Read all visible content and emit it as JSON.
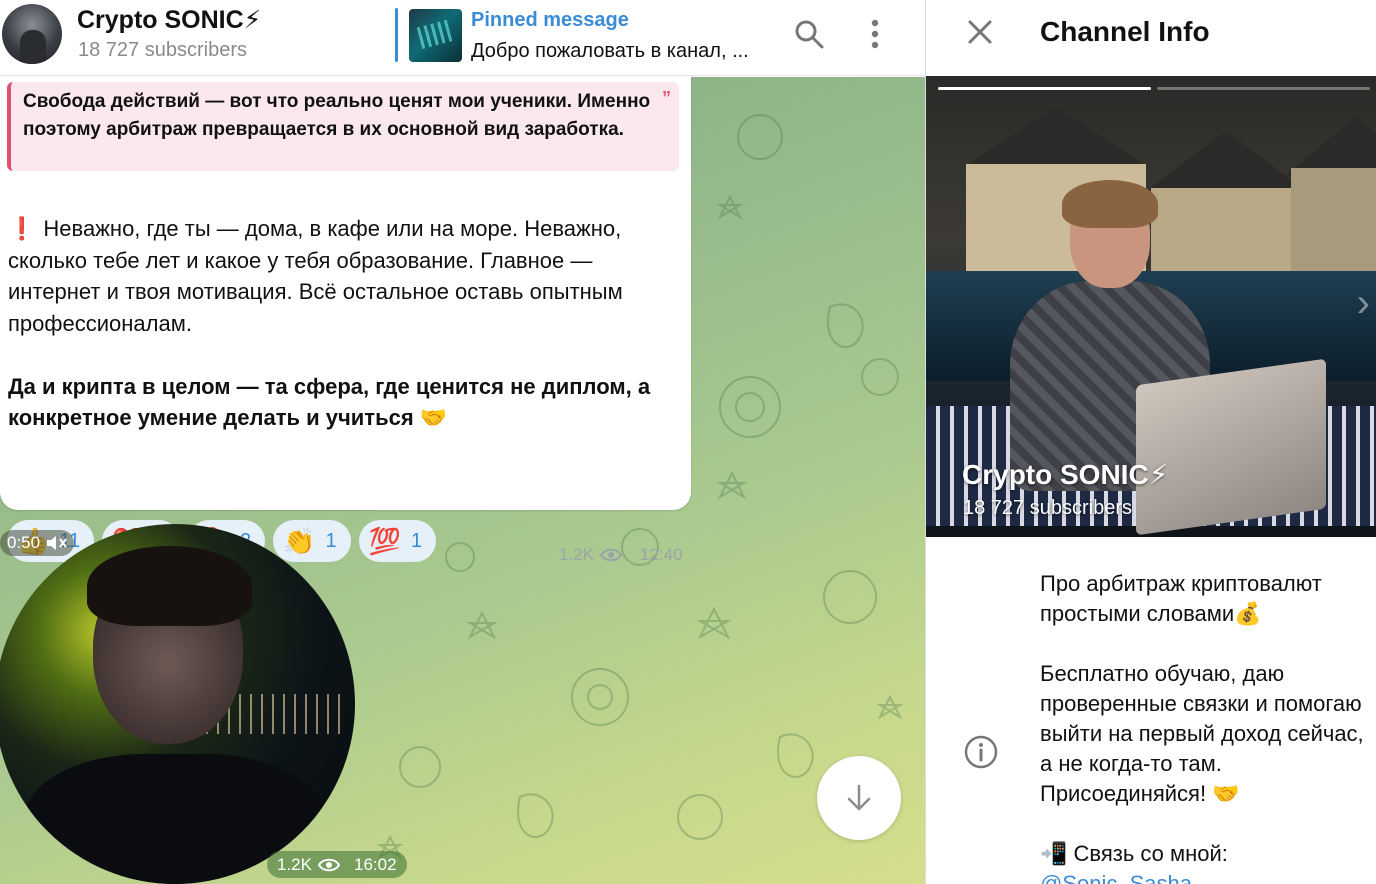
{
  "header": {
    "channel_name": "Crypto SONIC⚡",
    "subscribers": "18 727 subscribers",
    "pinned_label": "Pinned message",
    "pinned_text": "Добро пожаловать в канал, ..."
  },
  "message": {
    "quote": "Свобода действий — вот что реально ценят мои ученики. Именно поэтому арбитраж превращается в их основной вид заработка.",
    "para1_icon": "❗",
    "para1": "Неважно, где ты — дома, в кафе или на море. Неважно, сколько тебе лет и какое у тебя образование. Главное — интернет и твоя мотивация. Всё остальное оставь опытным профессионалам.",
    "para2": "Да и крипта в целом — та сфера, где ценится не диплом, а конкретное умение делать и учиться 🤝",
    "reactions": [
      {
        "emoji": "👍",
        "count": "11"
      },
      {
        "emoji": "❤️",
        "count": "5"
      },
      {
        "emoji": "🔥",
        "count": "2"
      },
      {
        "emoji": "👏",
        "count": "1"
      },
      {
        "emoji": "💯",
        "count": "1"
      }
    ],
    "views": "1.2K",
    "time": "12:40"
  },
  "video": {
    "duration": "0:50",
    "views": "1.2K",
    "time": "16:02"
  },
  "panel": {
    "title": "Channel Info",
    "photo_title": "Crypto SONIC⚡",
    "photo_sub": "18 727 subscribers",
    "about_p1": "Про арбитраж криптовалют простыми словами💰",
    "about_p2": "Бесплатно обучаю, даю проверенные связки и помогаю выйти на первый доход сейчас, а не когда-то там. Присоединяйся! 🤝",
    "about_p3": "📲 Связь со мной:",
    "about_link": "@Sonic_Sasha"
  },
  "colors": {
    "accent": "#3a8bd8",
    "quote_bar": "#e04f74",
    "quote_bg": "#fbe8ec"
  }
}
